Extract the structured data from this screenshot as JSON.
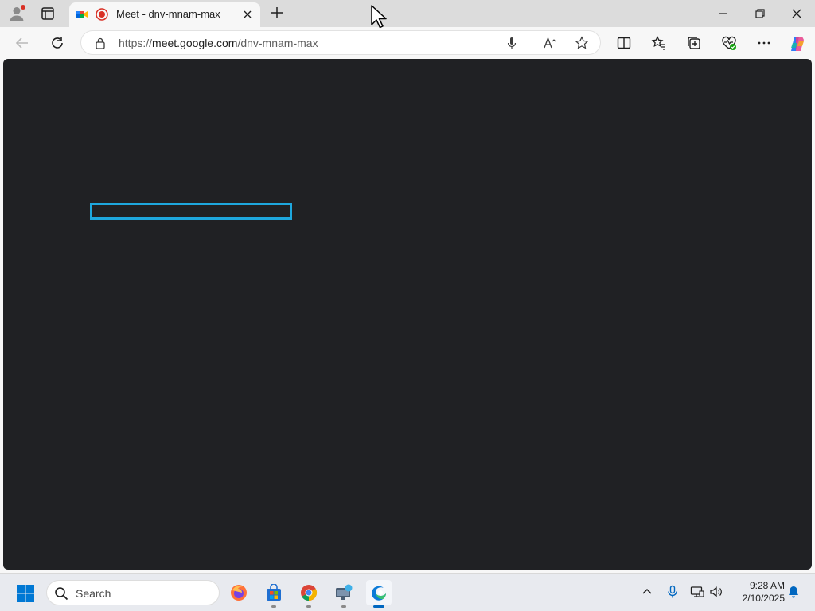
{
  "browser": {
    "tab": {
      "title": "Meet - dnv-mnam-max"
    },
    "address_bar": {
      "url_prefix": "https://",
      "url_host": "meet.google.com",
      "url_path": "/dnv-mnam-max"
    }
  },
  "colors": {
    "content_background": "#202124",
    "focus_outline": "#1ea7de",
    "recording_red": "#d93025",
    "taskbar_accent": "#0067c0"
  },
  "taskbar": {
    "search_placeholder": "Search",
    "apps": [
      "firefox-icon",
      "microsoft-store-icon",
      "chrome-icon",
      "remote-desktop-icon",
      "edge-icon"
    ],
    "active_app": "edge-icon"
  },
  "clock": {
    "time": "9:28 AM",
    "date": "2/10/2025"
  }
}
